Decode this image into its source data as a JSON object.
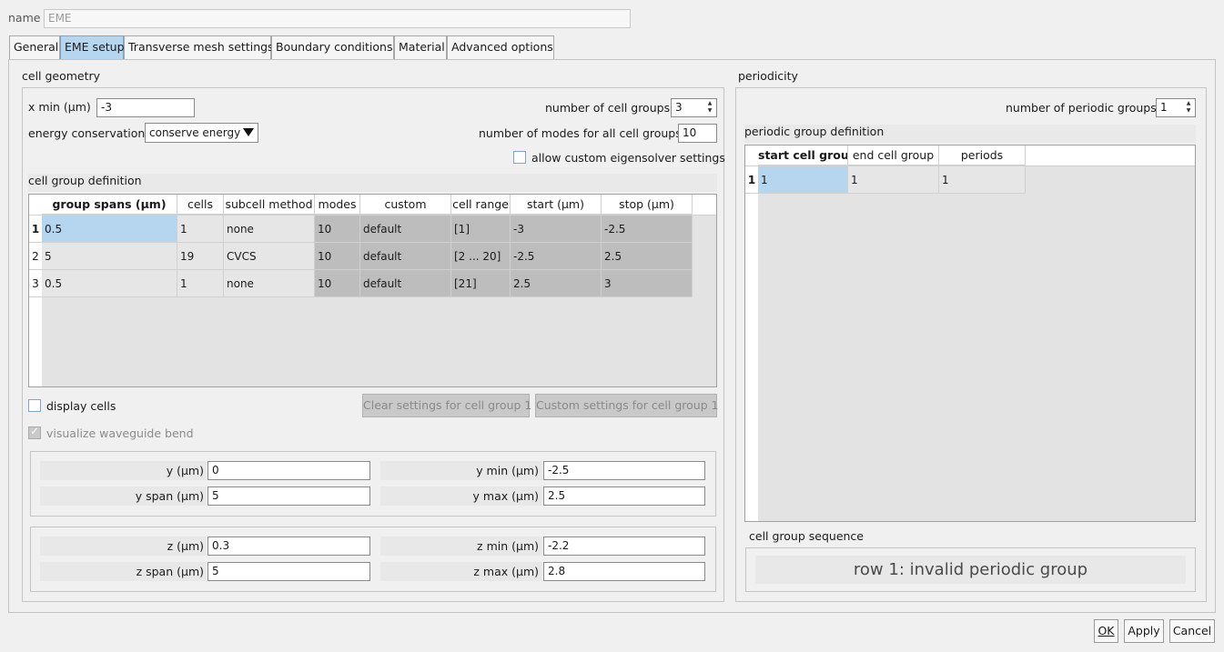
{
  "top": {
    "name_label": "name",
    "name_value": "EME"
  },
  "tabs": [
    {
      "label": "General"
    },
    {
      "label": "EME setup"
    },
    {
      "label": "Transverse mesh settings"
    },
    {
      "label": "Boundary conditions"
    },
    {
      "label": "Material"
    },
    {
      "label": "Advanced options"
    }
  ],
  "cell_geometry": {
    "title": "cell geometry",
    "xmin_label": "x min (μm)",
    "xmin_value": "-3",
    "energy_label": "energy conservation",
    "energy_value": "conserve energy",
    "num_groups_label": "number of cell groups",
    "num_groups_value": "3",
    "num_modes_label": "number of modes for all cell groups",
    "num_modes_value": "10",
    "allow_custom_label": "allow custom eigensolver settings",
    "group_def_title": "cell group definition",
    "table": {
      "headers": [
        "group spans (μm)",
        "cells",
        "subcell method",
        "modes",
        "custom",
        "cell range",
        "start (μm)",
        "stop (μm)"
      ],
      "rows": [
        {
          "num": "1",
          "cells": [
            "0.5",
            "1",
            "none",
            "10",
            "default",
            "[1]",
            "-3",
            "-2.5"
          ]
        },
        {
          "num": "2",
          "cells": [
            "5",
            "19",
            "CVCS",
            "10",
            "default",
            "[2 ... 20]",
            "-2.5",
            "2.5"
          ]
        },
        {
          "num": "3",
          "cells": [
            "0.5",
            "1",
            "none",
            "10",
            "default",
            "[21]",
            "2.5",
            "3"
          ]
        }
      ]
    },
    "display_cells_label": "display cells",
    "clear_btn": "Clear settings for cell group 1",
    "custom_btn": "Custom settings for cell group 1",
    "visualize_label": "visualize waveguide bend",
    "y_label": "y (μm)",
    "y_value": "0",
    "yspan_label": "y span (μm)",
    "yspan_value": "5",
    "ymin_label": "y min (μm)",
    "ymin_value": "-2.5",
    "ymax_label": "y max (μm)",
    "ymax_value": "2.5",
    "z_label": "z (μm)",
    "z_value": "0.3",
    "zspan_label": "z span (μm)",
    "zspan_value": "5",
    "zmin_label": "z min (μm)",
    "zmin_value": "-2.2",
    "zmax_label": "z max (μm)",
    "zmax_value": "2.8"
  },
  "periodicity": {
    "title": "periodicity",
    "num_periodic_label": "number of periodic groups",
    "num_periodic_value": "1",
    "group_def_title": "periodic group definition",
    "table": {
      "headers": [
        "start cell group",
        "end cell group",
        "periods"
      ],
      "rows": [
        {
          "num": "1",
          "cells": [
            "1",
            "1",
            "1"
          ]
        }
      ]
    },
    "sequence_title": "cell group sequence",
    "sequence_text": "row 1: invalid periodic group"
  },
  "footer": {
    "ok": "OK",
    "apply": "Apply",
    "cancel": "Cancel"
  }
}
